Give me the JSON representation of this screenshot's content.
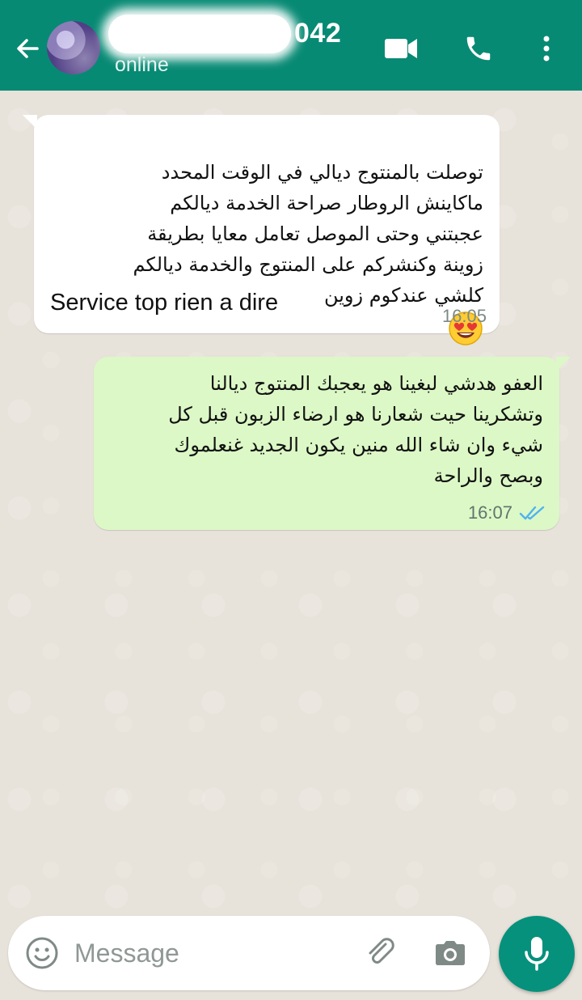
{
  "header": {
    "contact_name_visible": "042",
    "status": "online"
  },
  "messages": [
    {
      "direction": "incoming",
      "text": "توصلت بالمنتوج ديالي في الوقت المحدد\nماكاينش الروطار صراحة الخدمة ديالكم\nعجبتني وحتى الموصل تعامل معايا بطريقة\nزوينة وكنشركم على المنتوج والخدمة ديالكم\nكلشي عندكوم زوين",
      "emoji": "heart-eyes",
      "latin_text": "Service top rien a dire",
      "time": "16:05"
    },
    {
      "direction": "outgoing",
      "text": "العفو هدشي لبغينا هو يعجبك المنتوج ديالنا\nوتشكرينا حيت شعارنا هو ارضاء الزبون قبل كل\nشيء وان شاء الله منين يكون الجديد غنعلموك\nوبصح والراحة",
      "time": "16:07",
      "status": "read"
    }
  ],
  "composer": {
    "placeholder": "Message"
  },
  "icons": {
    "back": "arrow-left-icon",
    "video": "video-call-icon",
    "call": "phone-icon",
    "more": "more-vertical-icon",
    "emoji": "emoji-icon",
    "attach": "paperclip-icon",
    "camera": "camera-icon",
    "mic": "microphone-icon"
  },
  "colors": {
    "header": "#078a74",
    "chat_bg": "#e7e2da",
    "incoming_bubble": "#ffffff",
    "outgoing_bubble": "#dcf8c6",
    "mic_button": "#06917c",
    "read_ticks": "#4fb3f0"
  }
}
